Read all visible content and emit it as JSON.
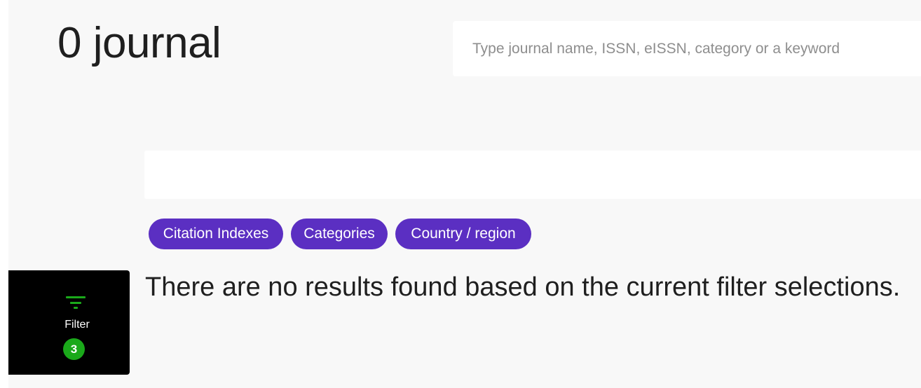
{
  "header": {
    "title": "0 journal"
  },
  "search": {
    "placeholder": "Type journal name, ISSN, eISSN, category or a keyword",
    "value": ""
  },
  "filter_chips": [
    {
      "label": "Citation Indexes"
    },
    {
      "label": "Categories"
    },
    {
      "label": "Country / region"
    }
  ],
  "filter_panel": {
    "icon": "filter-icon",
    "label": "Filter",
    "count": "3"
  },
  "results": {
    "message": "There are no results found based on the current filter selections."
  },
  "colors": {
    "page_background": "#f8f8f8",
    "chip_background": "#5b2fc2",
    "filter_panel_background": "#000000",
    "filter_accent": "#1aa91a"
  }
}
